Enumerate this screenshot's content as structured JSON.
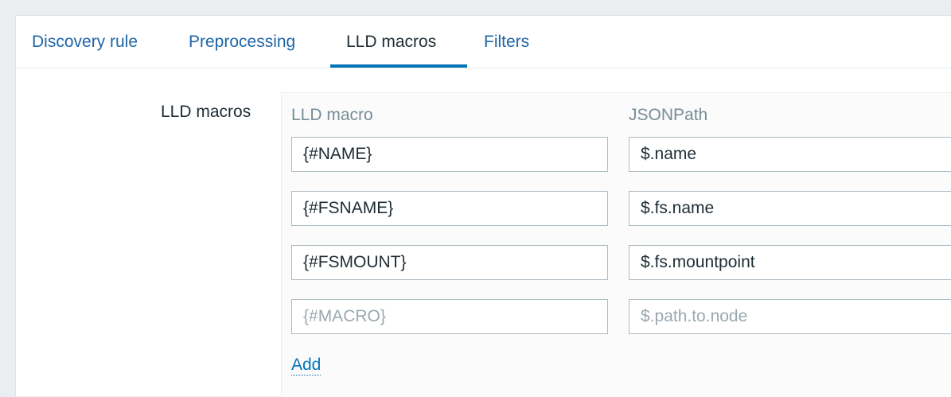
{
  "tabs": [
    {
      "label": "Discovery rule"
    },
    {
      "label": "Preprocessing"
    },
    {
      "label": "LLD macros",
      "active": true
    },
    {
      "label": "Filters"
    }
  ],
  "form": {
    "label": "LLD macros",
    "columns": {
      "macro": "LLD macro",
      "path": "JSONPath"
    },
    "rows": [
      {
        "macro": "{#NAME}",
        "path": "$.name"
      },
      {
        "macro": "{#FSNAME}",
        "path": "$.fs.name"
      },
      {
        "macro": "{#FSMOUNT}",
        "path": "$.fs.mountpoint"
      },
      {
        "macro": "",
        "path": ""
      }
    ],
    "placeholders": {
      "macro": "{#MACRO}",
      "path": "$.path.to.node"
    },
    "add_label": "Add"
  }
}
